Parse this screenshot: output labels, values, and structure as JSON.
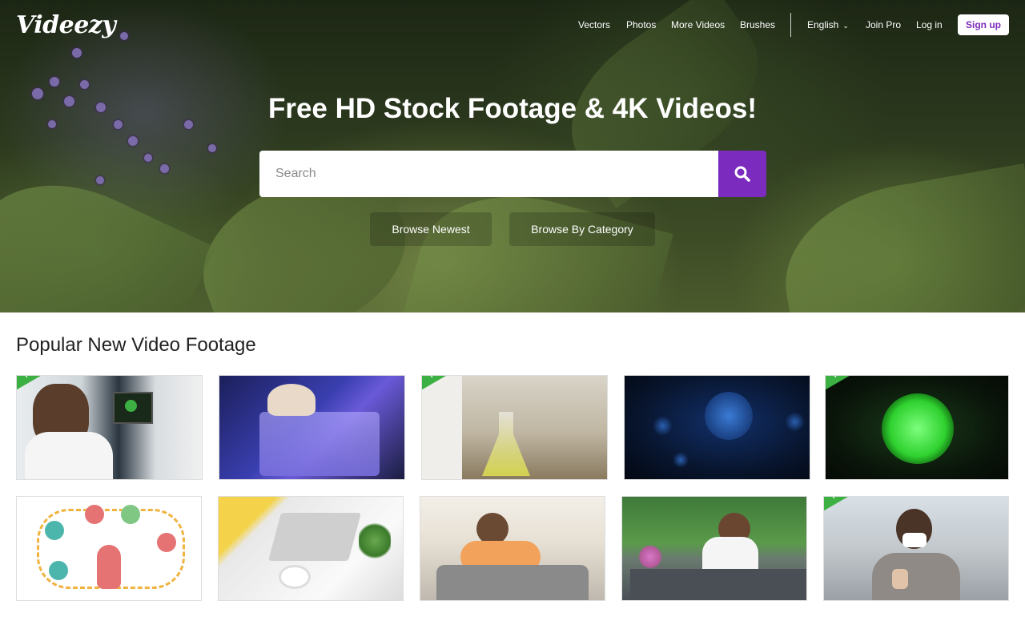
{
  "brand": {
    "logo_text": "Videezy",
    "accent_color": "#7b2cbf"
  },
  "nav": {
    "links": [
      "Vectors",
      "Photos",
      "More Videos",
      "Brushes"
    ],
    "language": "English",
    "join_pro": "Join Pro",
    "log_in": "Log in",
    "sign_up": "Sign up"
  },
  "hero": {
    "headline": "Free HD Stock Footage & 4K Videos!",
    "search_placeholder": "Search",
    "browse_newest": "Browse Newest",
    "browse_category": "Browse By Category"
  },
  "popular": {
    "title": "Popular New Video Footage",
    "badge_text": "PRO",
    "thumbnails": [
      {
        "pro": true,
        "icon": "scientist-microscope"
      },
      {
        "pro": false,
        "icon": "lab-test-tubes"
      },
      {
        "pro": true,
        "icon": "lab-flask"
      },
      {
        "pro": false,
        "icon": "virus-blue"
      },
      {
        "pro": true,
        "icon": "green-cell"
      },
      {
        "pro": false,
        "icon": "online-shopping-illustration"
      },
      {
        "pro": false,
        "icon": "laptop-typing"
      },
      {
        "pro": false,
        "icon": "couple-sofa-phones"
      },
      {
        "pro": false,
        "icon": "woman-coffee-table"
      },
      {
        "pro": true,
        "icon": "woman-mask-thumbs-up"
      }
    ]
  }
}
